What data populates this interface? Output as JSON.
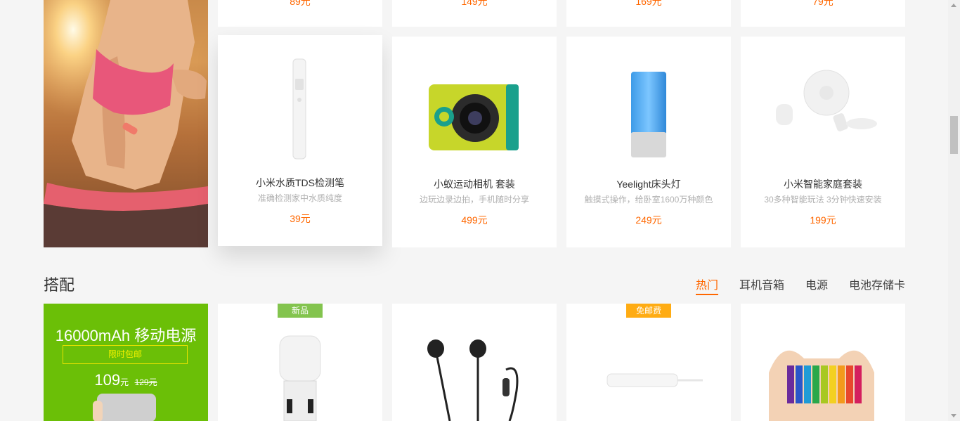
{
  "top_row_prices": [
    "89元",
    "149元",
    "169元",
    "79元"
  ],
  "featured_products": [
    {
      "name": "小米水质TDS检测笔",
      "desc": "准确检测家中水质纯度",
      "price": "39元"
    },
    {
      "name": "小蚁运动相机 套装",
      "desc": "边玩边录边拍，手机随时分享",
      "price": "499元"
    },
    {
      "name": "Yeelight床头灯",
      "desc": "触摸式操作，给卧室1600万种颜色",
      "price": "249元"
    },
    {
      "name": "小米智能家庭套装",
      "desc": "30多种智能玩法 3分钟快速安装",
      "price": "199元"
    }
  ],
  "section": {
    "title": "搭配",
    "tabs": [
      "热门",
      "耳机音箱",
      "电源",
      "电池存储卡"
    ],
    "active_tab": 0
  },
  "promo": {
    "title": "16000mAh 移动电源",
    "tag": "限时包邮",
    "price": "109",
    "price_unit": "元",
    "old_price": "129元"
  },
  "bottom_products": [
    {
      "badge": "新品",
      "badge_color": "#83c44e"
    },
    {
      "badge": "",
      "badge_color": ""
    },
    {
      "badge": "免邮费",
      "badge_color": "#ffac13"
    },
    {
      "badge": "",
      "badge_color": ""
    }
  ],
  "colors": {
    "accent": "#ff6700",
    "promo_green": "#6bbf07",
    "badge_new": "#83c44e",
    "badge_free": "#ffac13"
  }
}
